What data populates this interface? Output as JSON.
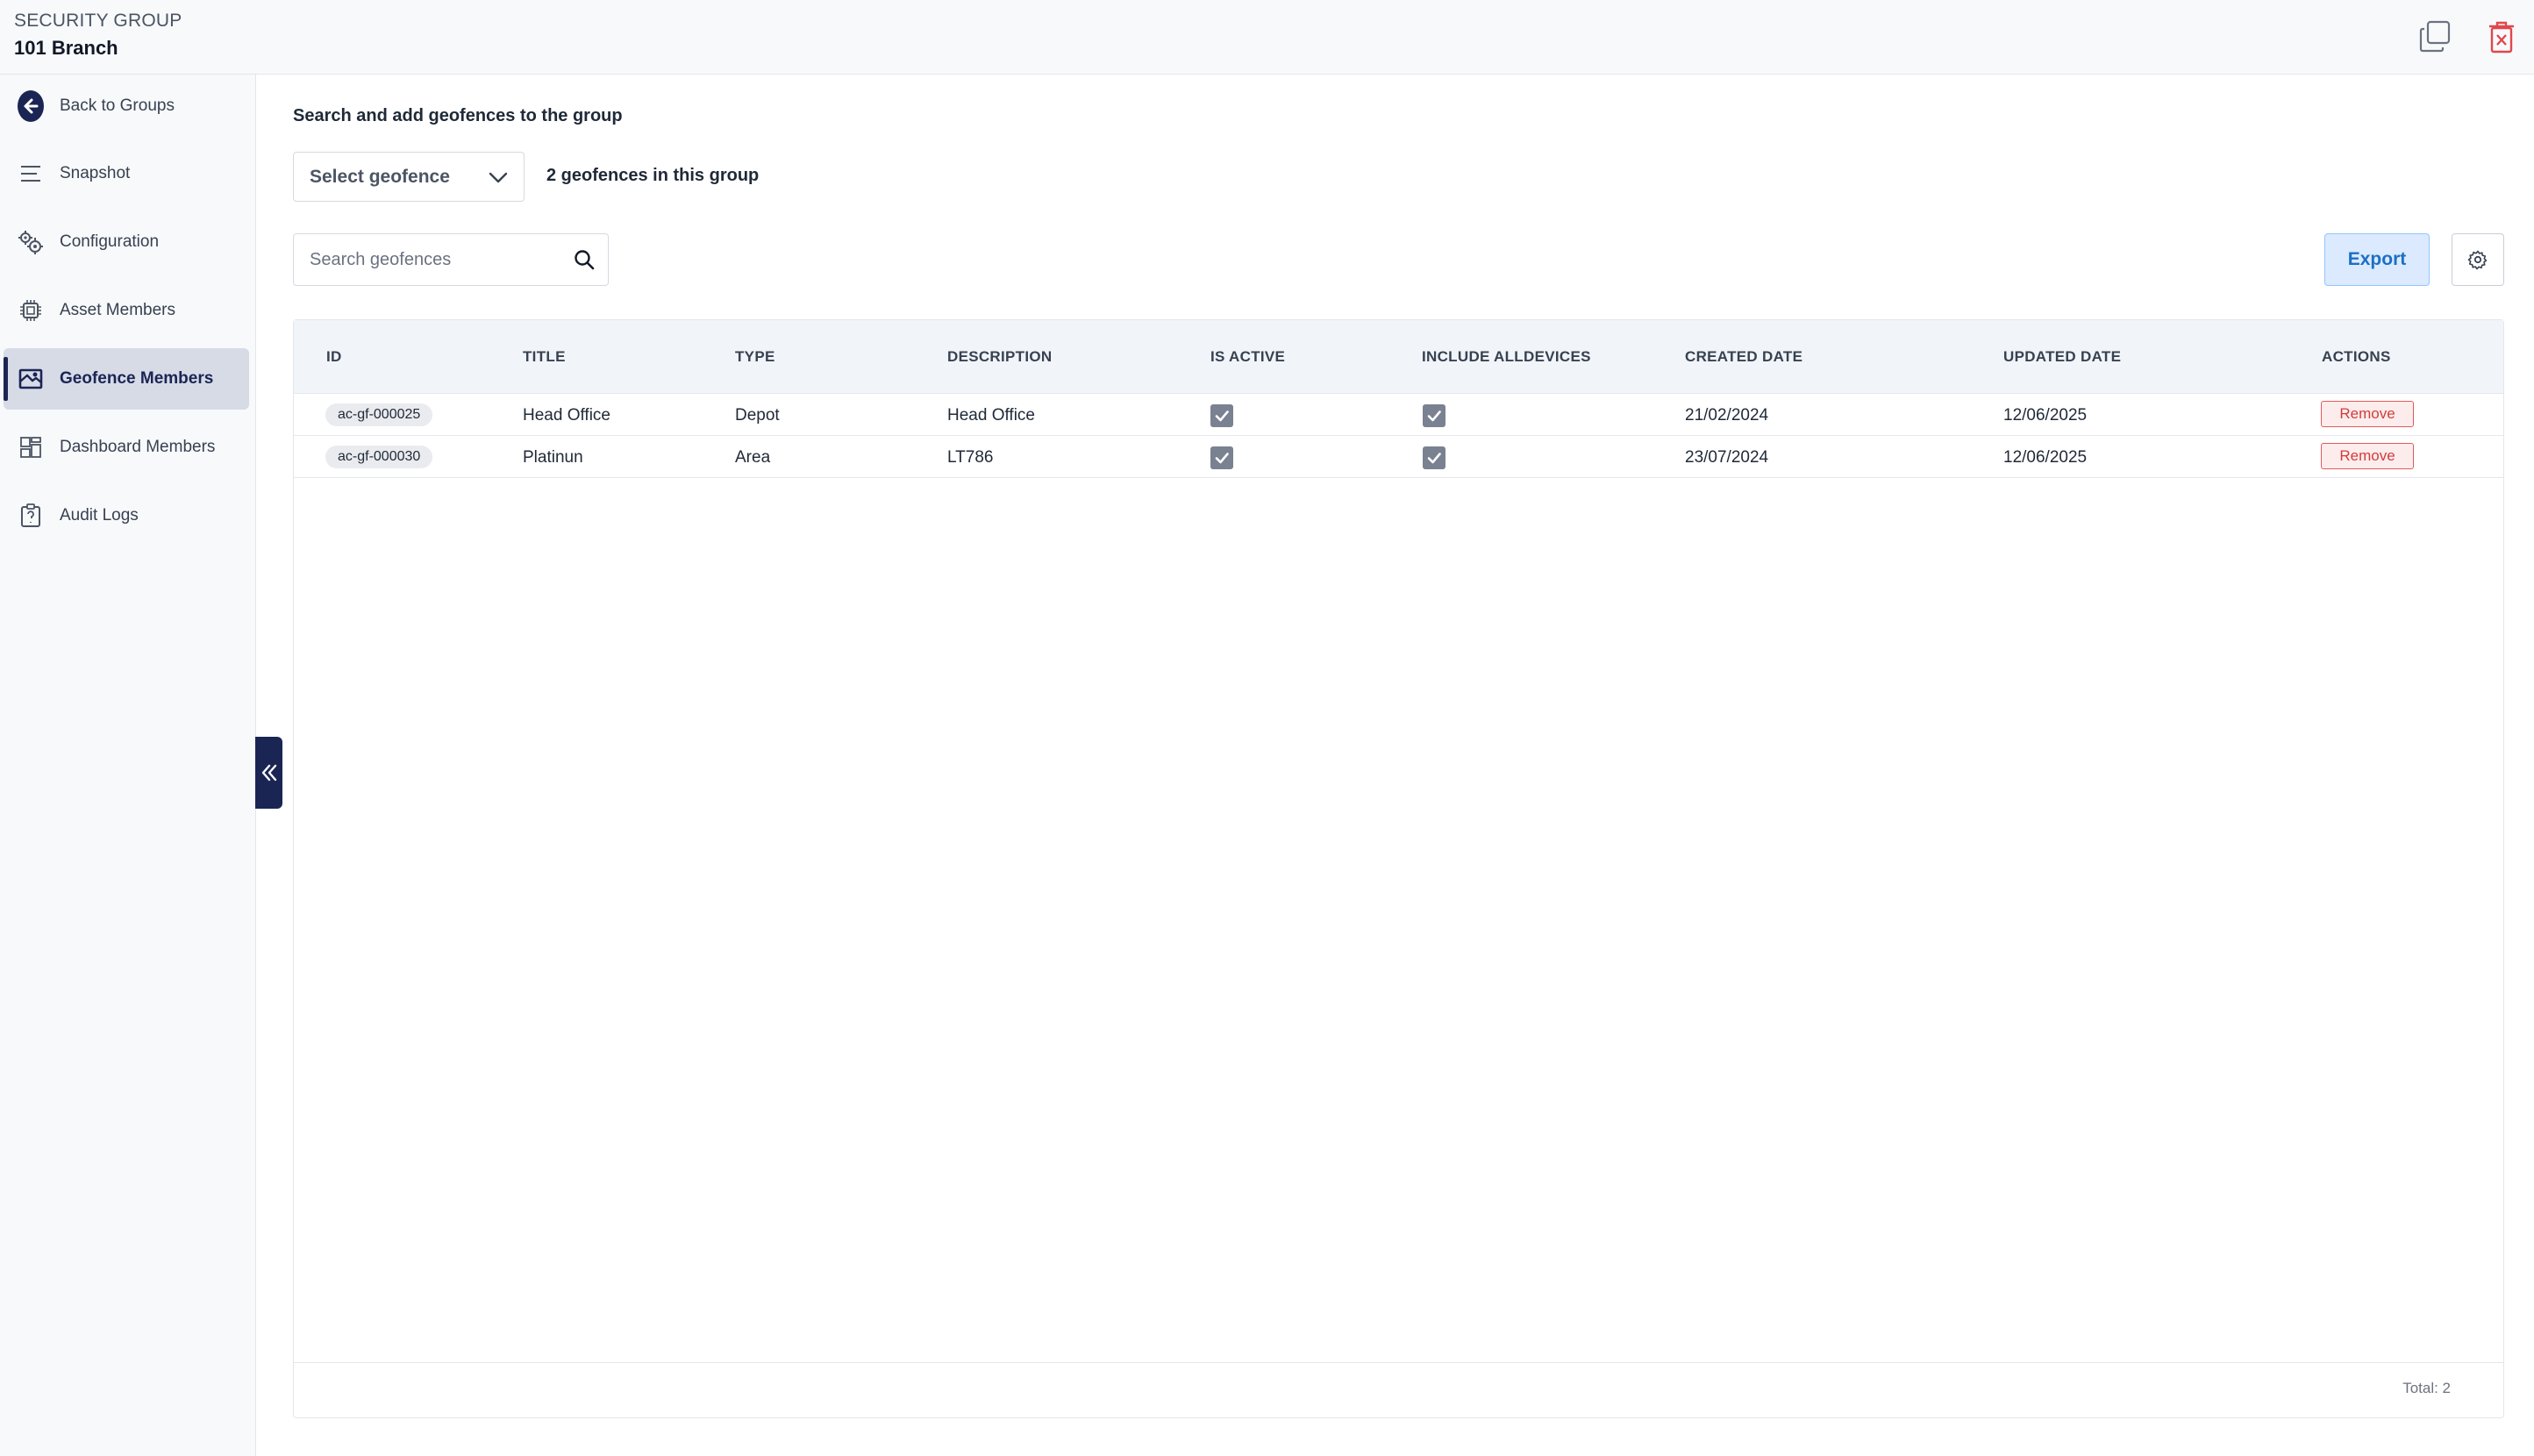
{
  "header": {
    "kicker": "SECURITY GROUP",
    "title": "101 Branch",
    "actions": {
      "copy_icon": "copy-icon",
      "delete_icon": "trash-icon",
      "delete_color": "#e0474c"
    }
  },
  "sidebar": {
    "back_label": "Back to Groups",
    "items": [
      {
        "label": "Snapshot",
        "icon": "list-icon"
      },
      {
        "label": "Configuration",
        "icon": "gears-icon"
      },
      {
        "label": "Asset Members",
        "icon": "chip-icon"
      },
      {
        "label": "Geofence Members",
        "icon": "map-icon",
        "active": true
      },
      {
        "label": "Dashboard Members",
        "icon": "dashboard-icon"
      },
      {
        "label": "Audit Logs",
        "icon": "clipboard-icon"
      }
    ],
    "accent": "#1b2554"
  },
  "main": {
    "section_title": "Search and add geofences to the group",
    "select_label": "Select geofence",
    "count_text": "2 geofences in this group",
    "search_placeholder": "Search geofences",
    "export_label": "Export"
  },
  "table": {
    "columns": [
      "ID",
      "TITLE",
      "TYPE",
      "DESCRIPTION",
      "IS ACTIVE",
      "INCLUDE ALLDEVICES",
      "CREATED DATE",
      "UPDATED DATE",
      "ACTIONS"
    ],
    "rows": [
      {
        "id": "ac-gf-000025",
        "title": "Head Office",
        "type": "Depot",
        "description": "Head Office",
        "is_active": true,
        "include_all_devices": true,
        "created": "21/02/2024",
        "updated": "12/06/2025",
        "action": "Remove"
      },
      {
        "id": "ac-gf-000030",
        "title": "Platinun",
        "type": "Area",
        "description": "LT786",
        "is_active": true,
        "include_all_devices": true,
        "created": "23/07/2024",
        "updated": "12/06/2025",
        "action": "Remove"
      }
    ],
    "total": "Total: 2"
  }
}
